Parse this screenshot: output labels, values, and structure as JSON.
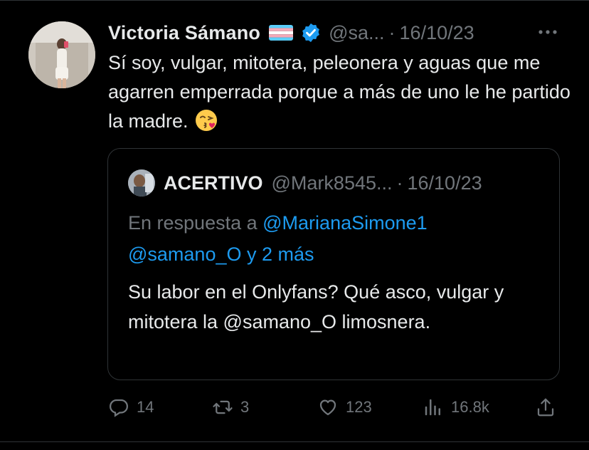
{
  "tweet": {
    "author_name": "Victoria Sámano",
    "handle": "@sa...",
    "separator": "·",
    "date": "16/10/23",
    "text": "Sí soy, vulgar, mitotera, peleonera y aguas que me agarren emperrada porque a más de uno le he partido la madre."
  },
  "quote": {
    "author_name": "ACERTIVO",
    "handle": "@Mark8545...",
    "separator": "·",
    "date": "16/10/23",
    "reply_prefix": "En respuesta a",
    "reply_mention_1": "@MarianaSimone1",
    "reply_mention_2": "@samano_O",
    "reply_suffix": "y 2 más",
    "text": "Su labor en el Onlyfans? Qué asco, vulgar y mitotera la @samano_O limosnera."
  },
  "actions": {
    "replies": "14",
    "retweets": "3",
    "likes": "123",
    "views": "16.8k"
  },
  "icons": {
    "flag": "transgender-flag-icon",
    "verified": "verified-badge-icon",
    "more": "more-icon",
    "emoji": "kissing-face-emoji-icon",
    "reply": "reply-icon",
    "retweet": "retweet-icon",
    "like": "heart-icon",
    "views": "views-icon",
    "share": "share-icon"
  },
  "colors": {
    "background": "#000000",
    "text": "#e7e9ea",
    "secondary": "#71767b",
    "accent": "#1d9bf0",
    "border": "#2f3336"
  }
}
